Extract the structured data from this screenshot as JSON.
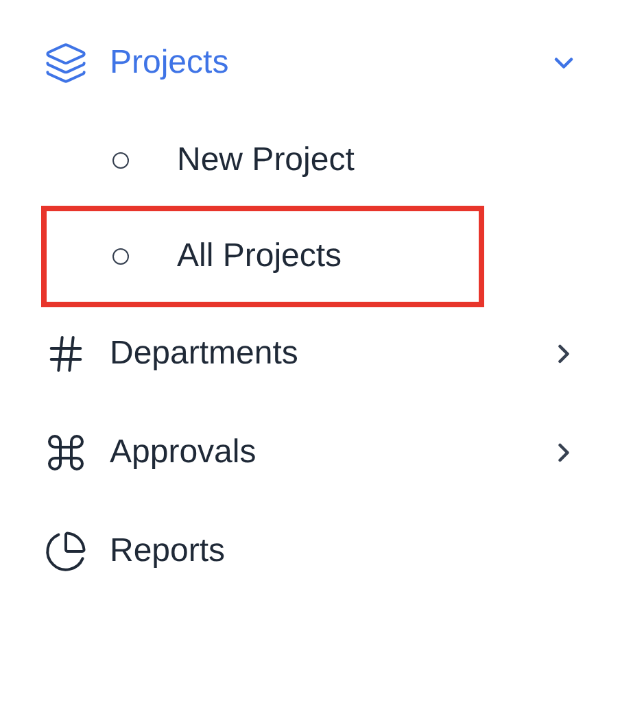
{
  "menu": [
    {
      "label": "Projects",
      "selected": true,
      "kind": "group",
      "expanded": true,
      "children": [
        {
          "label": "New Project",
          "highlighted": false
        },
        {
          "label": "All Projects",
          "highlighted": true
        }
      ]
    },
    {
      "label": "Departments",
      "selected": false,
      "kind": "group",
      "expanded": false
    },
    {
      "label": "Approvals",
      "selected": false,
      "kind": "group",
      "expanded": false
    },
    {
      "label": "Reports",
      "selected": false,
      "kind": "link"
    }
  ]
}
